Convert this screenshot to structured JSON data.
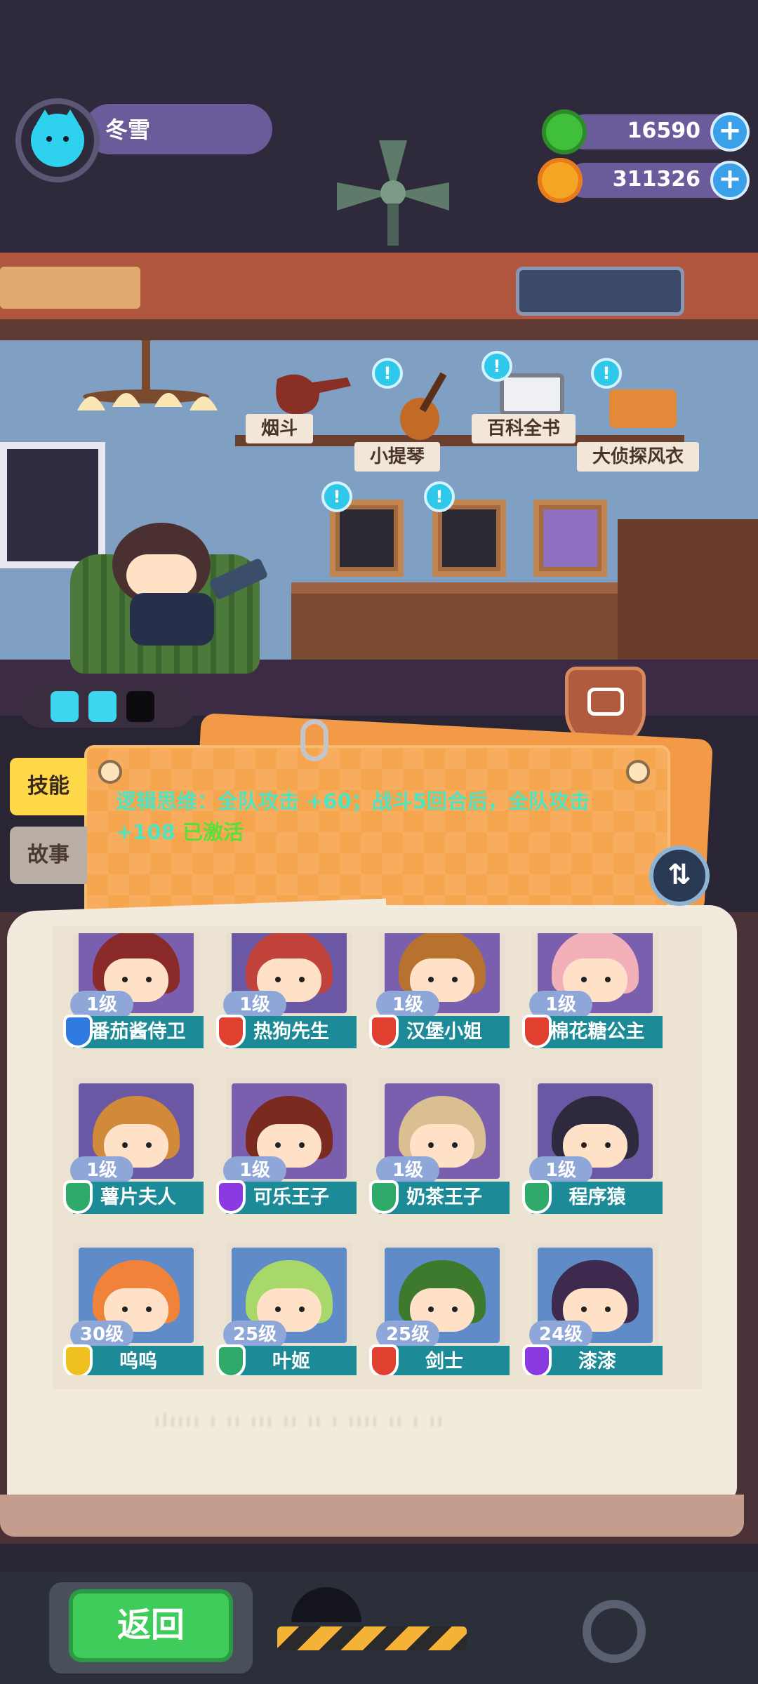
{
  "player": {
    "name": "冬雪"
  },
  "currencies": [
    {
      "name": "green-coin",
      "value": "16590",
      "color": "#3fbf3a"
    },
    {
      "name": "planet-coin",
      "value": "311326",
      "color": "#f5a524"
    }
  ],
  "room_items": [
    {
      "label": "烟斗"
    },
    {
      "label": "小提琴"
    },
    {
      "label": "百科全书"
    },
    {
      "label": "大侦探风衣"
    }
  ],
  "side_tabs": {
    "skill": "技能",
    "story": "故事"
  },
  "skill": {
    "description": "逻辑思维：全队攻击 +60；战斗5回合后，全队攻击 +108",
    "status": "已激活"
  },
  "characters": [
    {
      "level": "1级",
      "name": "番茄酱侍卫",
      "class_color": "#2f7be0",
      "hair": "#8a2a2a",
      "bg": "#7a5fae"
    },
    {
      "level": "1级",
      "name": "热狗先生",
      "class_color": "#e0402f",
      "hair": "#c0423a",
      "bg": "#6b58a5"
    },
    {
      "level": "1级",
      "name": "汉堡小姐",
      "class_color": "#e0402f",
      "hair": "#b8722f",
      "bg": "#7a5fae"
    },
    {
      "level": "1级",
      "name": "棉花糖公主",
      "class_color": "#e0402f",
      "hair": "#f2b0b8",
      "bg": "#7a5fae"
    },
    {
      "level": "1级",
      "name": "薯片夫人",
      "class_color": "#2faa6a",
      "hair": "#d08a3a",
      "bg": "#6b58a5"
    },
    {
      "level": "1级",
      "name": "可乐王子",
      "class_color": "#8a3ae0",
      "hair": "#7a2a1e",
      "bg": "#7a5fae"
    },
    {
      "level": "1级",
      "name": "奶茶王子",
      "class_color": "#2faa6a",
      "hair": "#d9bf92",
      "bg": "#7a5fae"
    },
    {
      "level": "1级",
      "name": "程序猿",
      "class_color": "#2faa6a",
      "hair": "#2e2a3e",
      "bg": "#6b58a5"
    },
    {
      "level": "30级",
      "name": "呜呜",
      "class_color": "#f0c020",
      "hair": "#f0823a",
      "bg": "#5f8cc8"
    },
    {
      "level": "25级",
      "name": "叶姬",
      "class_color": "#2faa6a",
      "hair": "#a8d86a",
      "bg": "#5f8cc8"
    },
    {
      "level": "25级",
      "name": "剑士",
      "class_color": "#e0402f",
      "hair": "#3e7a2e",
      "bg": "#5f8cc8"
    },
    {
      "level": "24级",
      "name": "漆漆",
      "class_color": "#8a3ae0",
      "hair": "#3e2a4e",
      "bg": "#5f8cc8"
    }
  ],
  "book_footer_blurred": "ılıııı ı ıı ııı   ıı ıı ı ıııı ıı ı ıı",
  "bottom": {
    "back_label": "返回"
  }
}
